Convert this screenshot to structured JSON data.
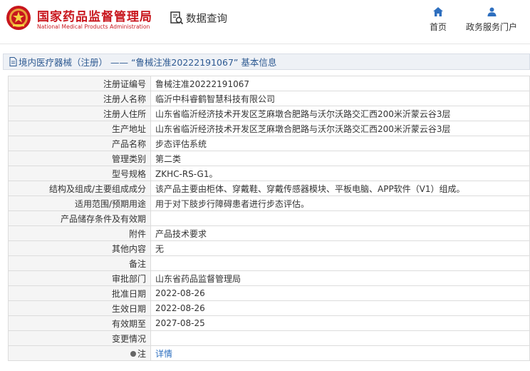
{
  "header": {
    "brand_cn": "国家药品监督管理局",
    "brand_en": "National Medical Products Administration",
    "query_label": "数据查询",
    "nav": {
      "home": "首页",
      "service": "政务服务门户"
    }
  },
  "titlebar": {
    "text": "境内医疗器械（注册） —— “鲁械注准20222191067” 基本信息"
  },
  "record": [
    {
      "label": "注册证编号",
      "value": "鲁械注准20222191067"
    },
    {
      "label": "注册人名称",
      "value": "临沂中科睿鹤智慧科技有限公司"
    },
    {
      "label": "注册人住所",
      "value": "山东省临沂经济技术开发区芝麻墩合肥路与沃尔沃路交汇西200米沂蒙云谷3层"
    },
    {
      "label": "生产地址",
      "value": "山东省临沂经济技术开发区芝麻墩合肥路与沃尔沃路交汇西200米沂蒙云谷3层"
    },
    {
      "label": "产品名称",
      "value": "步态评估系统"
    },
    {
      "label": "管理类别",
      "value": "第二类"
    },
    {
      "label": "型号规格",
      "value": "ZKHC-RS-G1。"
    },
    {
      "label": "结构及组成/主要组成成分",
      "value": "该产品主要由柜体、穿戴鞋、穿戴传感器模块、平板电脑、APP软件（V1）组成。"
    },
    {
      "label": "适用范围/预期用途",
      "value": "用于对下肢步行障碍患者进行步态评估。"
    },
    {
      "label": "产品储存条件及有效期",
      "value": ""
    },
    {
      "label": "附件",
      "value": "产品技术要求"
    },
    {
      "label": "其他内容",
      "value": "无"
    },
    {
      "label": "备注",
      "value": ""
    },
    {
      "label": "审批部门",
      "value": "山东省药品监督管理局"
    },
    {
      "label": "批准日期",
      "value": "2022-08-26"
    },
    {
      "label": "生效日期",
      "value": "2022-08-26"
    },
    {
      "label": "有效期至",
      "value": "2027-08-25"
    },
    {
      "label": "变更情况",
      "value": ""
    }
  ],
  "note_row": {
    "label": "注",
    "link_text": "详情"
  },
  "colors": {
    "brand_red": "#c8161d",
    "link_blue": "#2e6fbf",
    "title_blue": "#2e5a92"
  },
  "icons": {
    "logo": "nmpa-emblem",
    "query": "search-document-icon",
    "home": "home-icon",
    "service": "user-icon",
    "title": "document-icon",
    "note": "bullet-icon"
  }
}
